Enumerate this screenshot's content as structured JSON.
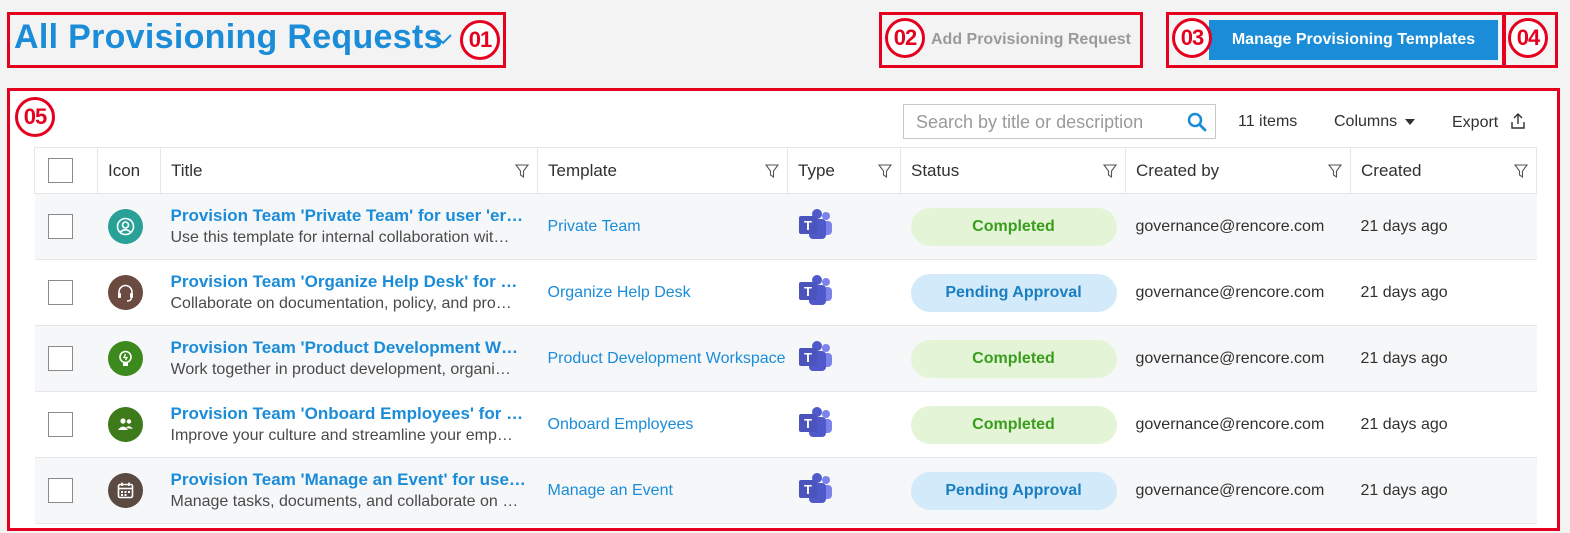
{
  "header": {
    "title": "All Provisioning Requests",
    "add_button": "Add Provisioning Request",
    "manage_button": "Manage Provisioning Templates"
  },
  "annotations": [
    "01",
    "02",
    "03",
    "04",
    "05"
  ],
  "toolbar": {
    "search_placeholder": "Search by title or description",
    "items_count": "11 items",
    "columns_label": "Columns",
    "export_label": "Export"
  },
  "table": {
    "headers": [
      "Icon",
      "Title",
      "Template",
      "Type",
      "Status",
      "Created by",
      "Created"
    ],
    "rows": [
      {
        "icon": "person-icon",
        "icon_color": "#2aa197",
        "title": "Provision Team 'Private Team' for user 'er…",
        "description": "Use this template for internal collaboration wit…",
        "template": "Private Team",
        "type": "teams-icon",
        "status": "Completed",
        "created_by": "governance@rencore.com",
        "created": "21 days ago"
      },
      {
        "icon": "headset-icon",
        "icon_color": "#6b4a3f",
        "title": "Provision Team 'Organize Help Desk' for …",
        "description": "Collaborate on documentation, policy, and pro…",
        "template": "Organize Help Desk",
        "type": "teams-icon",
        "status": "Pending Approval",
        "created_by": "governance@rencore.com",
        "created": "21 days ago"
      },
      {
        "icon": "lightbulb-icon",
        "icon_color": "#3c8a1e",
        "title": "Provision Team 'Product Development W…",
        "description": "Work together in product development, organi…",
        "template": "Product Development Workspace",
        "type": "teams-icon",
        "status": "Completed",
        "created_by": "governance@rencore.com",
        "created": "21 days ago"
      },
      {
        "icon": "people-icon",
        "icon_color": "#3c7a1a",
        "title": "Provision Team 'Onboard Employees' for …",
        "description": "Improve your culture and streamline your emp…",
        "template": "Onboard Employees",
        "type": "teams-icon",
        "status": "Completed",
        "created_by": "governance@rencore.com",
        "created": "21 days ago"
      },
      {
        "icon": "calendar-icon",
        "icon_color": "#5a4a42",
        "title": "Provision Team 'Manage an Event' for use…",
        "description": "Manage tasks, documents, and collaborate on …",
        "template": "Manage an Event",
        "type": "teams-icon",
        "status": "Pending Approval",
        "created_by": "governance@rencore.com",
        "created": "21 days ago"
      }
    ]
  },
  "colors": {
    "accent": "#1a8cd8",
    "annotation": "#e5001f",
    "completed_bg": "#e3f5d6",
    "pending_bg": "#d2eaf9"
  }
}
